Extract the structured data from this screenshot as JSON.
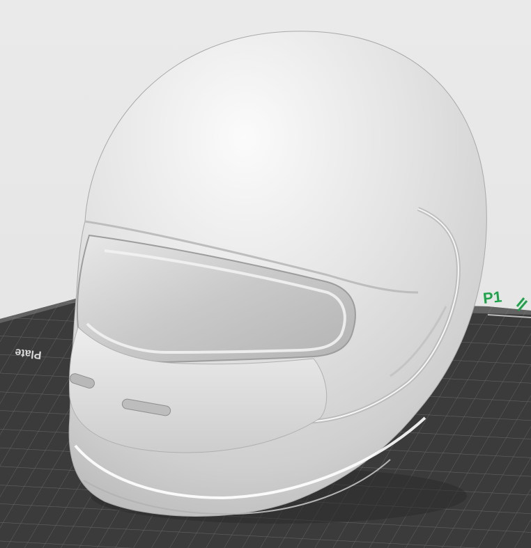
{
  "viewport": {
    "background": "#e6e6e6",
    "plate_color": "#3c3c3c",
    "grid_line_color": "#6a6a6a",
    "model_color": "#d4d4d4"
  },
  "build_plate": {
    "printer_label": "P1",
    "printer_label_color": "#1fa34a",
    "plate_text": "Plate"
  },
  "model": {
    "type": "full-face helmet",
    "icon": "helmet-icon"
  }
}
